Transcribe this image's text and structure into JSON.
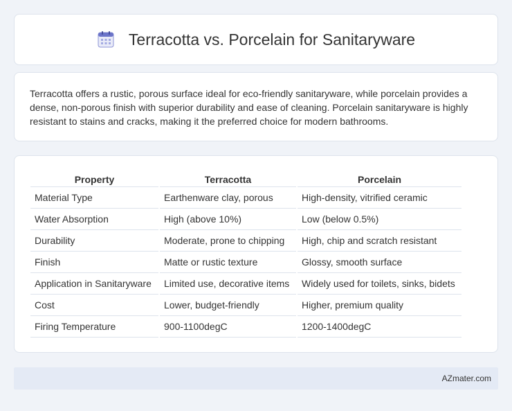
{
  "header": {
    "title": "Terracotta vs. Porcelain for Sanitaryware",
    "icon": "calendar-icon"
  },
  "intro": {
    "text": "Terracotta offers a rustic, porous surface ideal for eco-friendly sanitaryware, while porcelain provides a dense, non-porous finish with superior durability and ease of cleaning. Porcelain sanitaryware is highly resistant to stains and cracks, making it the preferred choice for modern bathrooms."
  },
  "table": {
    "headers": [
      "Property",
      "Terracotta",
      "Porcelain"
    ],
    "rows": [
      [
        "Material Type",
        "Earthenware clay, porous",
        "High-density, vitrified ceramic"
      ],
      [
        "Water Absorption",
        "High (above 10%)",
        "Low (below 0.5%)"
      ],
      [
        "Durability",
        "Moderate, prone to chipping",
        "High, chip and scratch resistant"
      ],
      [
        "Finish",
        "Matte or rustic texture",
        "Glossy, smooth surface"
      ],
      [
        "Application in Sanitaryware",
        "Limited use, decorative items",
        "Widely used for toilets, sinks, bidets"
      ],
      [
        "Cost",
        "Lower, budget-friendly",
        "Higher, premium quality"
      ],
      [
        "Firing Temperature",
        "900-1100degC",
        "1200-1400degC"
      ]
    ]
  },
  "footer": {
    "text": "AZmater.com"
  },
  "colors": {
    "background": "#f0f3f8",
    "card": "#ffffff",
    "footer": "#e4eaf5",
    "icon_accent": "#6b74c9"
  }
}
